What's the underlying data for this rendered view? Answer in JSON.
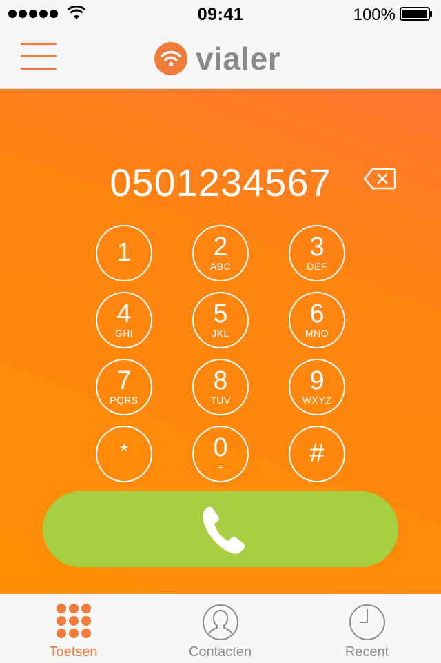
{
  "status_bar": {
    "time": "09:41",
    "battery_percent": "100%",
    "signal_bars": 5,
    "icons": [
      "signal-icon",
      "wifi-icon",
      "battery-icon"
    ]
  },
  "nav_bar": {
    "logo_text": "vialer",
    "icons": [
      "menu-icon",
      "vialer-logo-icon"
    ]
  },
  "dialer": {
    "number": "0501234567",
    "backspace_icon": "backspace-icon",
    "keys": [
      {
        "digit": "1",
        "letters": ""
      },
      {
        "digit": "2",
        "letters": "ABC"
      },
      {
        "digit": "3",
        "letters": "DEF"
      },
      {
        "digit": "4",
        "letters": "GHI"
      },
      {
        "digit": "5",
        "letters": "JKL"
      },
      {
        "digit": "6",
        "letters": "MNO"
      },
      {
        "digit": "7",
        "letters": "PQRS"
      },
      {
        "digit": "8",
        "letters": "TUV"
      },
      {
        "digit": "9",
        "letters": "WXYZ"
      },
      {
        "digit": "*",
        "letters": ""
      },
      {
        "digit": "0",
        "letters": "+"
      },
      {
        "digit": "#",
        "letters": ""
      }
    ],
    "call_icon": "phone-icon"
  },
  "tab_bar": {
    "tabs": [
      {
        "label": "Toetsen",
        "icon": "keypad-icon",
        "active": true
      },
      {
        "label": "Contacten",
        "icon": "contacts-icon",
        "active": false
      },
      {
        "label": "Recent",
        "icon": "clock-icon",
        "active": false
      }
    ]
  },
  "colors": {
    "accent": "#f07c3c",
    "dialer_gradient_top": "#ff7733",
    "dialer_gradient_bottom": "#ff8e06",
    "call_button": "#a5cf41",
    "tab_inactive": "#8c8c8c",
    "logo_text": "#8a8a8a"
  }
}
